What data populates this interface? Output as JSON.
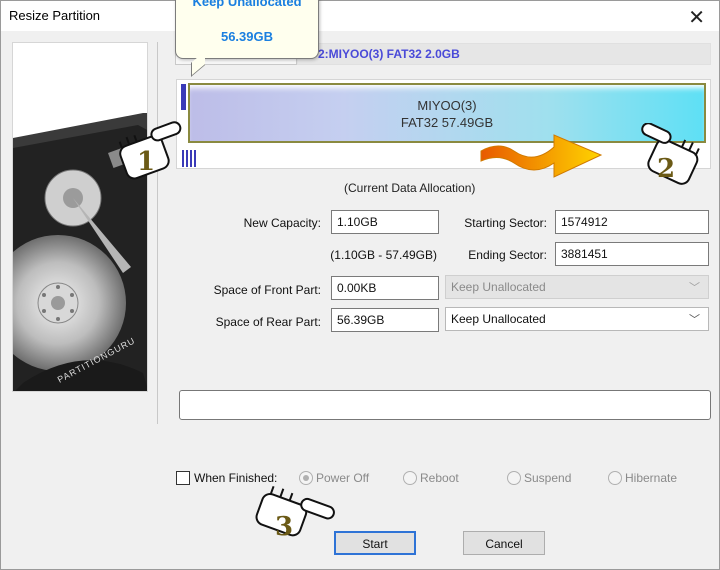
{
  "window": {
    "title": "Resize Partition"
  },
  "callout": {
    "title": "Keep Unallocated",
    "size": "56.39GB"
  },
  "partition_header": "2:MIYOO(3) FAT32 2.0GB",
  "bar": {
    "name": "MIYOO(3)",
    "detail": "FAT32 57.49GB"
  },
  "data_allocation": "(Current Data Allocation)",
  "fields": {
    "new_capacity": {
      "label": "New Capacity:",
      "value": "1.10GB",
      "range": "(1.10GB - 57.49GB)"
    },
    "starting_sector": {
      "label": "Starting Sector:",
      "value": "1574912"
    },
    "ending_sector": {
      "label": "Ending Sector:",
      "value": "3881451"
    },
    "front_space": {
      "label": "Space of Front Part:",
      "value": "0.00KB",
      "option": "Keep Unallocated"
    },
    "rear_space": {
      "label": "Space of Rear Part:",
      "value": "56.39GB",
      "option": "Keep Unallocated"
    }
  },
  "when_finished": {
    "label": "When Finished:",
    "options": [
      "Power Off",
      "Reboot",
      "Suspend",
      "Hibernate"
    ]
  },
  "buttons": {
    "start": "Start",
    "cancel": "Cancel"
  },
  "steps": [
    "1",
    "2",
    "3"
  ],
  "side_image_text": "PARTITIONGURU",
  "colors": {
    "callout_text": "#1a7fe0",
    "header_text": "#4a4ad8",
    "primary_border": "#2e73d6"
  }
}
